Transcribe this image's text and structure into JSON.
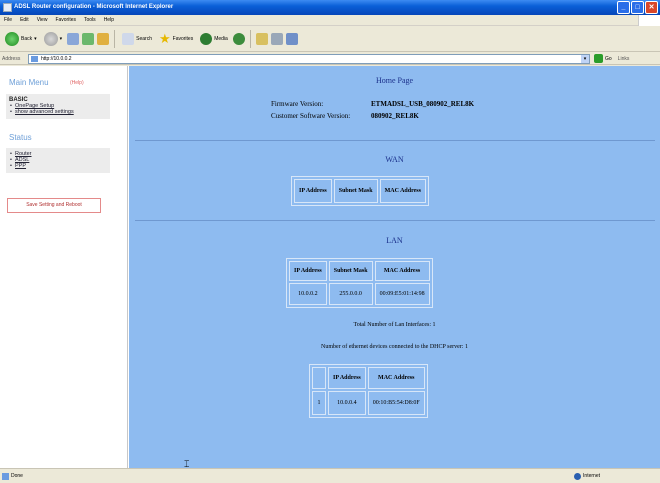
{
  "window": {
    "title": "ADSL Router configuration - Microsoft Internet Explorer"
  },
  "menu": [
    "File",
    "Edit",
    "View",
    "Favorites",
    "Tools",
    "Help"
  ],
  "toolbar": {
    "back": "Back",
    "search": "Search",
    "favorites": "Favorites",
    "media": "Media"
  },
  "address": {
    "label": "Address",
    "url": "http://10.0.0.2",
    "go": "Go",
    "links": "Links"
  },
  "sidebar": {
    "main_menu": "Main Menu",
    "help": "(Help)",
    "basic_head": "BASIC",
    "basic_items": [
      "OnePage Setup",
      "show advanced settings"
    ],
    "status_title": "Status",
    "status_items": [
      "Router",
      "ADSL",
      "PPP"
    ],
    "save_button": "Save Setting and Reboot"
  },
  "home": {
    "title": "Home Page",
    "firmware_label": "Firmware Version:",
    "firmware_value": "ETMADSL_USB_080902_REL8K",
    "customer_label": "Customer Software Version:",
    "customer_value": "080902_REL8K"
  },
  "wan": {
    "title": "WAN",
    "headers": [
      "IP Address",
      "Subnet Mask",
      "MAC Address"
    ]
  },
  "lan": {
    "title": "LAN",
    "headers": [
      "IP Address",
      "Subnet Mask",
      "MAC Address"
    ],
    "row": [
      "10.0.0.2",
      "255.0.0.0",
      "00:09:E5:01:14:98"
    ],
    "total_interfaces": "Total Number of Lan Interfaces: 1",
    "dhcp_devices": "Number of ethernet devices connected to the DHCP server: 1",
    "dhcp_headers": [
      "",
      "IP Address",
      "MAC Address"
    ],
    "dhcp_row": [
      "1",
      "10.0.0.4",
      "00:10:B5:54:D8:0F"
    ]
  },
  "statusbar": {
    "done": "Done",
    "zone": "Internet"
  }
}
